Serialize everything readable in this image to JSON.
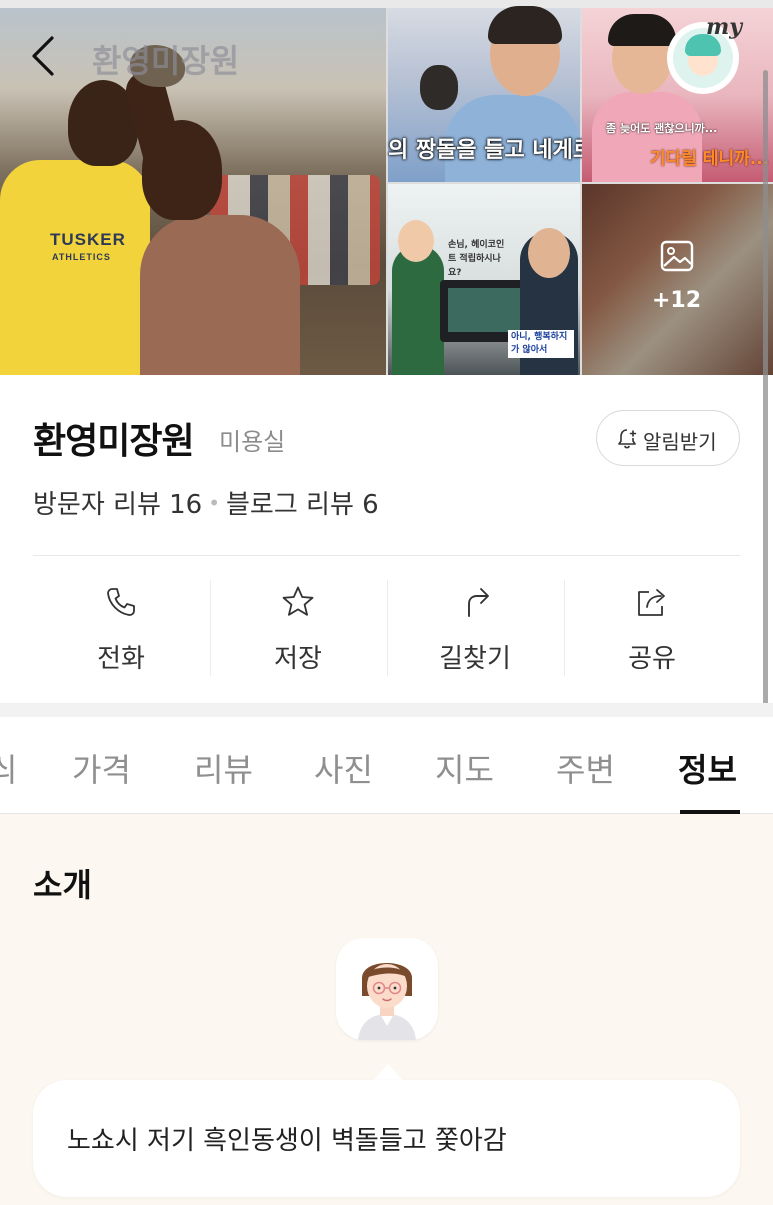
{
  "header": {
    "overlay_title": "환영미장원",
    "my_badge": "my",
    "photo_captions": {
      "top_middle": "의 짱돌을 들고 네게로 가",
      "top_right_line1": "좀 늦어도 괜찮으니까...",
      "top_right_line2": "기다릴 테니까...",
      "bottom_middle_bubble": "손님, 헤이코인트 적립하시나요?",
      "bottom_middle_caption": "아니, 행복하지가 않아서"
    },
    "shirt_logo_line1": "TUSKER",
    "shirt_logo_line2": "ATHLETICS",
    "more_photos": "+12"
  },
  "place": {
    "name": "환영미장원",
    "category": "미용실",
    "notify_label": "알림받기",
    "visitor_reviews": "방문자 리뷰 16",
    "blog_reviews": "블로그 리뷰 6"
  },
  "actions": [
    {
      "label": "전화",
      "icon": "phone-icon"
    },
    {
      "label": "저장",
      "icon": "star-icon"
    },
    {
      "label": "길찾기",
      "icon": "directions-icon"
    },
    {
      "label": "공유",
      "icon": "share-icon"
    }
  ],
  "tabs": [
    "싀",
    "가격",
    "리뷰",
    "사진",
    "지도",
    "주변",
    "정보"
  ],
  "active_tab": "정보",
  "intro": {
    "title": "소개",
    "message": "노쇼시 저기 흑인동생이 벽돌들고 쫓아감"
  },
  "colors": {
    "accent_text": "#111111",
    "muted_text": "#8f8f8f",
    "intro_background": "#fcf8f1"
  }
}
